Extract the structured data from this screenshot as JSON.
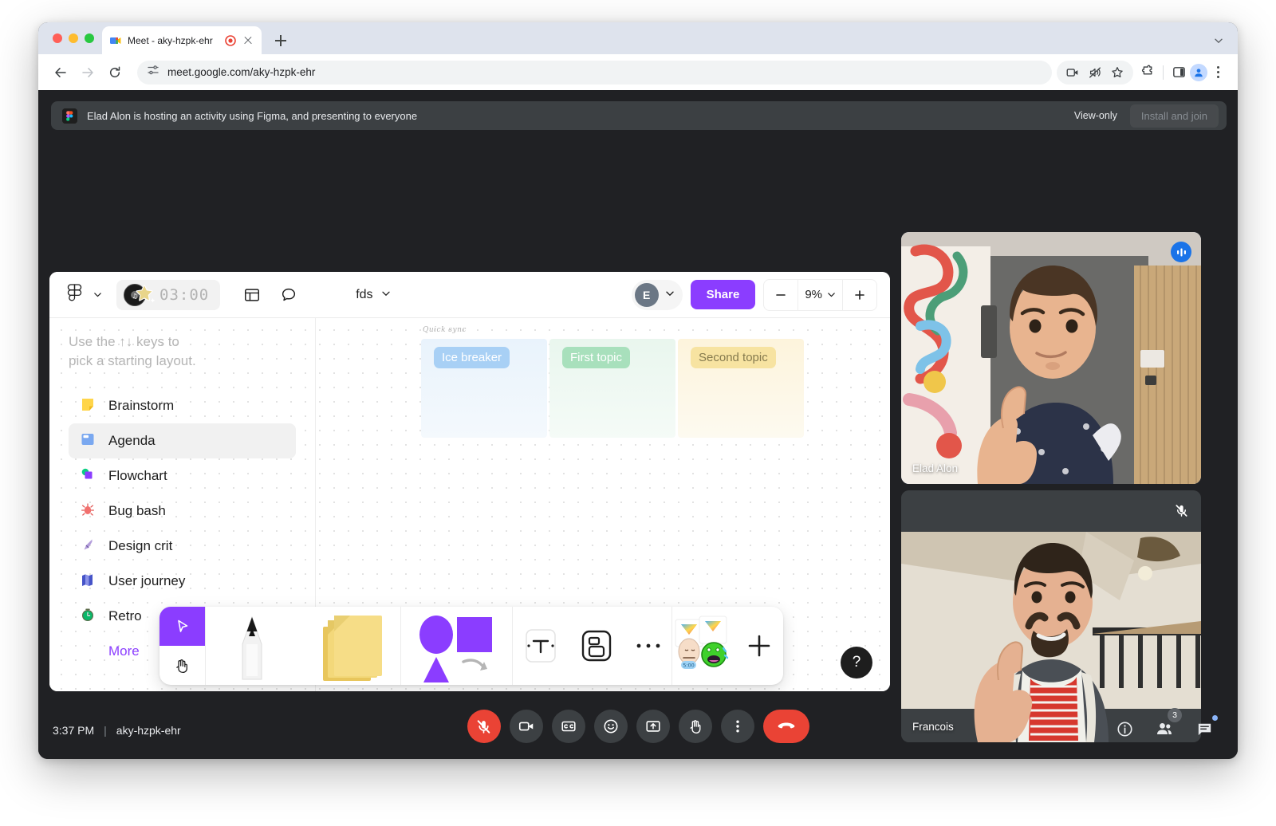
{
  "browser": {
    "tab": {
      "title": "Meet - aky-hzpk-ehr",
      "favicon_icon": "google-meet-icon",
      "recording_icon": "recording-indicator-icon",
      "close_icon": "close-icon"
    },
    "new_tab_icon": "plus-icon",
    "window_chevron_icon": "chevron-down-icon",
    "back_icon": "back-arrow-icon",
    "forward_icon": "forward-arrow-icon",
    "reload_icon": "reload-icon",
    "site_settings_icon": "tune-icon",
    "url": "meet.google.com/aky-hzpk-ehr",
    "toolbar_icons": [
      "screen-share-icon",
      "mute-tab-icon",
      "bookmark-star-icon",
      "extensions-puzzle-icon",
      "side-panel-icon",
      "profile-avatar-icon",
      "chrome-menu-kebab-icon"
    ]
  },
  "banner": {
    "app_icon": "figma-icon",
    "text": "Elad Alon is hosting an activity using Figma, and presenting to everyone",
    "view_only_label": "View-only",
    "install_button_label": "Install and join"
  },
  "figma": {
    "logo_icon": "figma-logo-icon",
    "logo_chevron_icon": "chevron-down-icon",
    "timer": {
      "value": "03:00",
      "sticker_icon": "vinyl-record-star-sticker-icon"
    },
    "layout_icon": "layout-grid-icon",
    "comment_icon": "comment-bubble-icon",
    "filename": "fds",
    "filename_chevron_icon": "chevron-down-icon",
    "avatar_initial": "E",
    "avatar_chevron_icon": "chevron-down-icon",
    "share_label": "Share",
    "zoom": {
      "minus_icon": "minus-icon",
      "value": "9%",
      "chevron_icon": "chevron-down-icon",
      "plus_icon": "plus-icon"
    },
    "accent_color": "#8b3dff",
    "hint": "Use the ↑↓ keys to\npick a starting layout.",
    "templates": [
      {
        "label": "Brainstorm",
        "emoji": "🗒",
        "icon": "sticky-note-icon",
        "selected": false
      },
      {
        "label": "Agenda",
        "emoji": "🗂",
        "icon": "agenda-card-icon",
        "selected": true
      },
      {
        "label": "Flowchart",
        "emoji": "🟩",
        "icon": "flowchart-icon",
        "selected": false
      },
      {
        "label": "Bug bash",
        "emoji": "🐞",
        "icon": "bug-icon",
        "selected": false
      },
      {
        "label": "Design crit",
        "emoji": "🖊",
        "icon": "pen-nib-icon",
        "selected": false
      },
      {
        "label": "User journey",
        "emoji": "🗺",
        "icon": "map-icon",
        "selected": false
      },
      {
        "label": "Retro",
        "emoji": "⏱",
        "icon": "stopwatch-icon",
        "selected": false
      },
      {
        "label": "More",
        "emoji": "",
        "icon": "",
        "selected": false
      }
    ],
    "board": {
      "title": "Quick sync",
      "columns": [
        {
          "label": "Ice breaker",
          "color": "#a8d0f5"
        },
        {
          "label": "First topic",
          "color": "#a8e0bc"
        },
        {
          "label": "Second topic",
          "color": "#f7e3a1"
        }
      ]
    },
    "tools": [
      {
        "name": "cursor-tool",
        "icon": "cursor-arrow-icon",
        "active": true
      },
      {
        "name": "hand-tool",
        "icon": "hand-pan-icon",
        "active": false
      },
      {
        "name": "pen-tool",
        "icon": "marker-pen-icon",
        "active": false
      },
      {
        "name": "sticky-note-tool",
        "icon": "sticky-notes-stack-icon",
        "active": false
      },
      {
        "name": "shapes-tool",
        "icon": "shapes-icon",
        "active": false
      },
      {
        "name": "text-tool",
        "icon": "text-T-icon",
        "active": false
      },
      {
        "name": "frame-tool",
        "icon": "frame-icon",
        "active": false
      },
      {
        "name": "more-tools",
        "icon": "ellipsis-icon",
        "active": false
      },
      {
        "name": "stickers-tool",
        "icon": "stickers-icon",
        "active": false
      },
      {
        "name": "add-widget",
        "icon": "plus-icon",
        "active": false
      }
    ],
    "help_label": "?"
  },
  "meet": {
    "tiles": [
      {
        "name": "Elad Alon",
        "speaking": true,
        "muted": false,
        "badge_icon": "audio-level-icon"
      },
      {
        "name": "Francois",
        "speaking": false,
        "muted": true,
        "badge_icon": "mic-off-icon"
      }
    ],
    "status": {
      "time": "3:37 PM",
      "separator": "|",
      "code": "aky-hzpk-ehr"
    },
    "controls": [
      {
        "name": "microphone-button",
        "icon": "mic-off-icon",
        "state": "muted",
        "color": "#ea4335"
      },
      {
        "name": "camera-button",
        "icon": "video-camera-icon",
        "state": "on",
        "color": "#3c4043"
      },
      {
        "name": "captions-button",
        "icon": "closed-captions-icon",
        "state": "off",
        "color": "#3c4043"
      },
      {
        "name": "reactions-button",
        "icon": "smiley-face-icon",
        "state": "off",
        "color": "#3c4043"
      },
      {
        "name": "present-button",
        "icon": "present-screen-icon",
        "state": "off",
        "color": "#3c4043"
      },
      {
        "name": "raise-hand-button",
        "icon": "raised-hand-icon",
        "state": "off",
        "color": "#3c4043"
      },
      {
        "name": "more-options-button",
        "icon": "kebab-menu-icon",
        "state": "off",
        "color": "#3c4043"
      },
      {
        "name": "leave-call-button",
        "icon": "phone-hangup-icon",
        "state": "on",
        "color": "#ea4335"
      }
    ],
    "right_controls": [
      {
        "name": "meeting-details-button",
        "icon": "info-circle-icon",
        "badge": ""
      },
      {
        "name": "people-button",
        "icon": "people-icon",
        "badge": "3"
      },
      {
        "name": "chat-button",
        "icon": "chat-bubble-icon",
        "badge": ""
      }
    ]
  }
}
